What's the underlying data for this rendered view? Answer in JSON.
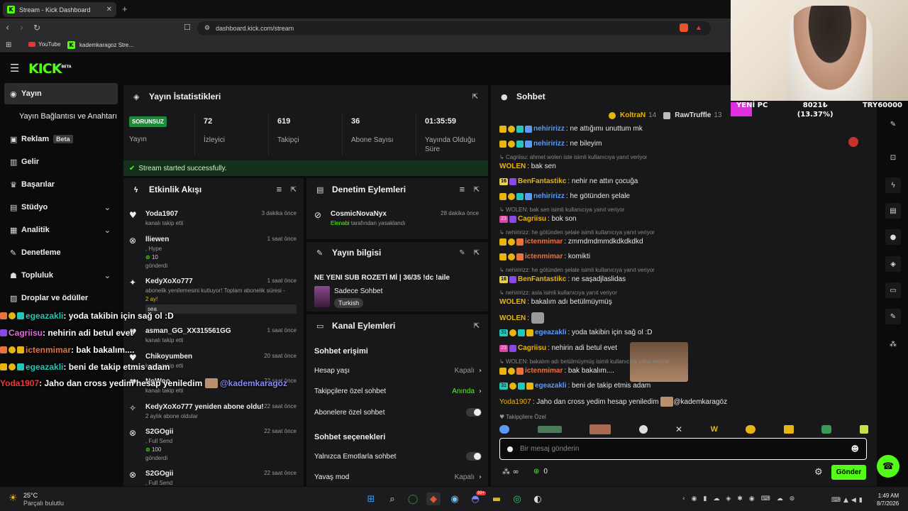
{
  "browser": {
    "tab_title": "Stream - Kick Dashboard",
    "url": "dashboard.kick.com/stream",
    "bookmarks": [
      "YouTube",
      "kademkaragoz Stre..."
    ]
  },
  "brand": {
    "logo": "KICK",
    "logo_sup": "BETA",
    "accent": "#53fc18"
  },
  "sidebar": {
    "items": [
      {
        "label": "Yayın",
        "icon": "broadcast-icon"
      },
      {
        "label": "Yayın Bağlantısı ve Anahtarı"
      },
      {
        "label": "Reklam",
        "badge": "Beta",
        "icon": "ad-icon"
      },
      {
        "label": "Gelir",
        "icon": "chart-icon"
      },
      {
        "label": "Başarılar",
        "icon": "trophy-icon"
      },
      {
        "label": "Stüdyo",
        "icon": "studio-icon"
      },
      {
        "label": "Analitik",
        "icon": "analytics-icon"
      },
      {
        "label": "Denetleme",
        "icon": "wrench-icon"
      },
      {
        "label": "Topluluk",
        "icon": "community-icon"
      },
      {
        "label": "Droplar ve ödüller",
        "icon": "gift-icon"
      }
    ]
  },
  "stats": {
    "title": "Yayın İstatistikleri",
    "status": "SORUNSUZ",
    "status_label": "Yayın",
    "items": [
      {
        "value": "72",
        "label": "İzleyici"
      },
      {
        "value": "619",
        "label": "Takipçi"
      },
      {
        "value": "36",
        "label": "Abone Sayısı"
      },
      {
        "value": "01:35:59",
        "label": "Yayında Olduğu Süre"
      }
    ],
    "success": "Stream started successfully."
  },
  "activity": {
    "title": "Etkinlik Akışı",
    "events": [
      {
        "user": "Yoda1907",
        "time": "3 dakika önce",
        "desc": "kanalı takip etti"
      },
      {
        "user": "lliewen",
        "time": "1 saat önce",
        "desc": ", Hype",
        "extra": "10",
        "extra2": "gönderdi"
      },
      {
        "user": "KedyXoXo777",
        "time": "1 saat önce",
        "desc": "abonelik yenilemesini kutluyor! Toplam abonelik süresi -",
        "extra": "2 ay!",
        "msg": "sea"
      },
      {
        "user": "asman_GG_XX315561GG",
        "time": "1 saat önce",
        "desc": "kanalı takip etti"
      },
      {
        "user": "Chikoyumben",
        "time": "20 saat önce",
        "desc": "kanalı takip etti"
      },
      {
        "user": "NoWoo",
        "time": "22 saat önce",
        "desc": "kanalı takip etti"
      },
      {
        "user": "KedyXoXo777 yeniden abone oldu!",
        "time": "22 saat önce",
        "desc": "2 aylık abone oldular"
      },
      {
        "user": "S2GOgii",
        "time": "22 saat önce",
        "desc": ", Full Send",
        "extra": "100",
        "extra2": "gönderdi"
      },
      {
        "user": "S2GOgii",
        "time": "22 saat önce",
        "desc": ", Full Send"
      }
    ]
  },
  "moderation": {
    "title": "Denetim Eylemleri",
    "user": "CosmicNovaNyx",
    "time": "28 dakika önce",
    "by": "Elenabi",
    "desc": "tarafından yasaklandı"
  },
  "streaminfo": {
    "title": "Yayın bilgisi",
    "stream_title": "NE YENI SUB ROZETİ Mİ | 36/35 !dc !aile",
    "category": "Sadece Sohbet",
    "tag": "Turkish"
  },
  "channel": {
    "title": "Kanal Eylemleri",
    "section1": "Sohbet erişimi",
    "section2": "Sohbet seçenekleri",
    "rows": [
      {
        "label": "Hesap yaşı",
        "value": "Kapalı"
      },
      {
        "label": "Takipçilere özel sohbet",
        "value": "Anında"
      },
      {
        "label": "Abonelere özel sohbet"
      },
      {
        "label": "Yalnızca Emotlarla sohbet"
      },
      {
        "label": "Yavaş mod",
        "value": "Kapalı"
      }
    ]
  },
  "chat": {
    "title": "Sohbet",
    "pinned": [
      {
        "user": "KoltraN",
        "count": "14"
      },
      {
        "user": "RawTruffle",
        "count": "13"
      }
    ],
    "messages": [
      {
        "user": "nehiririzz",
        "color": "#5b9bf6",
        "text": "ne attığımı unuttum mk"
      },
      {
        "user": "nehiririzz",
        "color": "#5b9bf6",
        "text": "ne bileyim"
      },
      {
        "reply": "Cagriisu: ahmet wolen iste isimli kullanıcıya yanıt veriyor"
      },
      {
        "user": "WOLEN",
        "color": "#e7b50f",
        "text": "bak sen"
      },
      {
        "user": "BenFantastikc",
        "color": "#e7b50f",
        "text": "nehir ne attın çocuğa",
        "num": "16"
      },
      {
        "user": "nehiririzz",
        "color": "#5b9bf6",
        "text": "he götünden şelale"
      },
      {
        "reply": "WOLEN: bak sen isimli kullanıcıya yanıt veriyor"
      },
      {
        "user": "Cagriisu",
        "color": "#e7b50f",
        "text": "bok son",
        "num": "23"
      },
      {
        "reply": "nehiririzz: he götünden şelale isimli kullanıcıya yanıt veriyor"
      },
      {
        "user": "ictenmimar",
        "color": "#e8743b",
        "text": "zmmdmdmmdkdkdkdkd"
      },
      {
        "user": "ictenmimar",
        "color": "#e8743b",
        "text": "komikti"
      },
      {
        "reply": "nehiririzz: he götünden şelale isimli kullanıcıya yanıt veriyor"
      },
      {
        "user": "BenFantastikc",
        "color": "#e7b50f",
        "text": "ne saşadjlaslidas",
        "num": "16"
      },
      {
        "reply": "nehiririzz: asla isimli kullanıcıya yanıt veriyor"
      },
      {
        "user": "WOLEN",
        "color": "#e7b50f",
        "text": "bakalım adı betülmüymüş"
      },
      {
        "user": "WOLEN",
        "color": "#e7b50f",
        "text": ""
      },
      {
        "user": "egeazakli",
        "color": "#5b9bf6",
        "text": "yoda takibin için sağ ol :D",
        "num": "31"
      },
      {
        "user": "Cagriisu",
        "color": "#e7b50f",
        "text": "nehirin adi betul evet",
        "num": "23"
      },
      {
        "reply": "WOLEN: bakalım adı betülmüymüş isimli kullanıcıya yanıt veriyor"
      },
      {
        "user": "ictenmimar",
        "color": "#e8743b",
        "text": "bak bakalım...."
      },
      {
        "user": "egeazakli",
        "color": "#5b9bf6",
        "text": "beni de takip etmis adam",
        "num": "31"
      },
      {
        "user": "Yoda1907",
        "color": "#e7b50f",
        "text": "Jaho dan cross yedim hesap yeniledim",
        "mention": "@kademkaragöz"
      }
    ],
    "followers_only": "Takipçilere Özel",
    "placeholder": "Bir mesaj gönderin",
    "send": "Gönder",
    "points": "0"
  },
  "overlay": [
    {
      "user": "egeazakli",
      "text": ": yoda takibin için sağ ol :D"
    },
    {
      "user": "Cagriisu",
      "text": ": nehirin adi betul evet"
    },
    {
      "user": "ictenmimar",
      "text": ": bak bakalım...."
    },
    {
      "user": "egeazakli",
      "text": ": beni de takip etmis adam"
    },
    {
      "user": "Yoda1907",
      "text": ": Jaho dan cross yedim hesap yeniledim",
      "mention": "@kademkaragöz"
    }
  ],
  "cam": {
    "label1": "YENİ PC",
    "value": "8021₺",
    "percent": "(13.37%)",
    "goal": "TRY60000"
  },
  "taskbar": {
    "temp": "25°C",
    "weather": "Parçalı bulutlu",
    "time": "1:49 AM",
    "date": "8/7/2026",
    "badge": "99+"
  }
}
